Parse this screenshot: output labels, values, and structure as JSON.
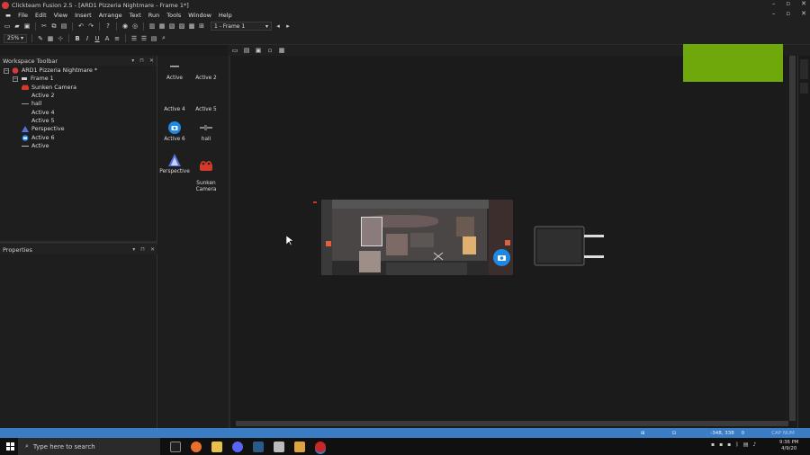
{
  "window": {
    "title": "Clickteam Fusion 2.5 - [ARD1 Pizzeria Nightmare - Frame 1*]",
    "controls": [
      "–",
      "▫",
      "✕"
    ]
  },
  "menu": {
    "items": [
      "File",
      "Edit",
      "View",
      "Insert",
      "Arrange",
      "Text",
      "Run",
      "Tools",
      "Window",
      "Help"
    ]
  },
  "toolbar": {
    "frame_combo": "1 - Frame 1",
    "zoom_combo": "25%"
  },
  "workspace": {
    "title": "Workspace Toolbar",
    "ctrl_labels": [
      "▾",
      "⊓",
      "✕"
    ],
    "tree": [
      {
        "label": "ARD1 Pizzeria Nightmare *",
        "level": 0,
        "toggle": "−",
        "icon": "application-icon"
      },
      {
        "label": "Frame 1",
        "level": 1,
        "toggle": "−",
        "icon": "frame-icon"
      },
      {
        "label": "Sunken Camera",
        "level": 2,
        "icon": "sunken-camera-icon"
      },
      {
        "label": "Active 2",
        "level": 2,
        "icon": "blank-icon"
      },
      {
        "label": "hall",
        "level": 2,
        "icon": "hall-icon"
      },
      {
        "label": "Active 4",
        "level": 2,
        "icon": "blank-icon"
      },
      {
        "label": "Active 5",
        "level": 2,
        "icon": "blank-icon"
      },
      {
        "label": "Perspective",
        "level": 2,
        "icon": "perspective-icon"
      },
      {
        "label": "Active 6",
        "level": 2,
        "icon": "camera-icon"
      },
      {
        "label": "Active",
        "level": 2,
        "icon": "active-icon"
      }
    ]
  },
  "properties": {
    "title": "Properties",
    "ctrl_labels": [
      "▾",
      "⊓",
      "✕"
    ]
  },
  "objects": [
    {
      "label": "Active",
      "icon": "active-icon"
    },
    {
      "label": "Active 2",
      "icon": "blank-icon"
    },
    {
      "label": "Active 4",
      "icon": "blank-icon"
    },
    {
      "label": "Active 5",
      "icon": "blank-icon"
    },
    {
      "label": "Active 6",
      "icon": "camera-icon"
    },
    {
      "label": "hall",
      "icon": "hall-icon"
    },
    {
      "label": "Perspective",
      "icon": "perspective-icon"
    },
    {
      "label": "Sunken\nCamera",
      "icon": "sunken-camera-icon"
    }
  ],
  "status": {
    "coords": "-348, 338",
    "layer": "0",
    "caps": "CAP  NUM"
  },
  "taskbar": {
    "search_placeholder": "Type here to search",
    "time": "9:36 PM",
    "date": "4/9/20"
  },
  "colors": {
    "accent": "#3b7dc4",
    "green_object": "#6fa80a",
    "camera_blue": "#1e88e5"
  }
}
